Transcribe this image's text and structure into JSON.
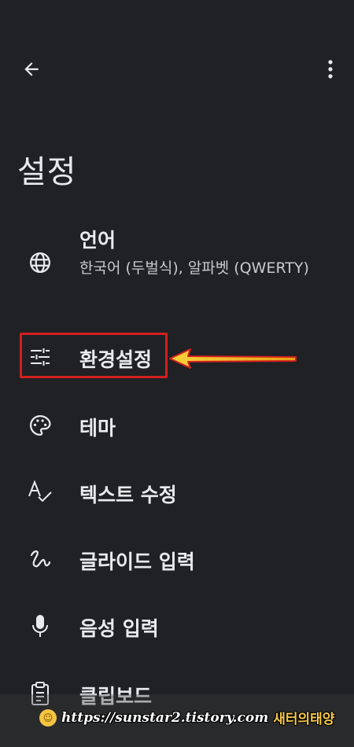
{
  "header": {
    "back_icon": "arrow-back-icon",
    "more_icon": "more-vert-icon"
  },
  "page": {
    "title": "설정"
  },
  "settings": {
    "items": [
      {
        "title": "언어",
        "summary": "한국어 (두벌식), 알파벳 (QWERTY)",
        "icon": "globe-icon"
      },
      {
        "title": "환경설정",
        "icon": "tune-sliders-icon"
      },
      {
        "title": "테마",
        "icon": "palette-icon"
      },
      {
        "title": "텍스트 수정",
        "icon": "spellcheck-icon"
      },
      {
        "title": "글라이드 입력",
        "icon": "gesture-icon"
      },
      {
        "title": "음성 입력",
        "icon": "microphone-icon"
      },
      {
        "title": "클립보드",
        "icon": "clipboard-icon"
      }
    ]
  },
  "annotation": {
    "highlight_color": "#d31f1f",
    "arrow_color": "#e8a317"
  },
  "watermark": {
    "url": "https://sunstar2.tistory.com",
    "name": "새터의태양"
  },
  "colors": {
    "background": "#202124",
    "text_primary": "#e8eaed",
    "text_secondary": "#c8cacd"
  }
}
